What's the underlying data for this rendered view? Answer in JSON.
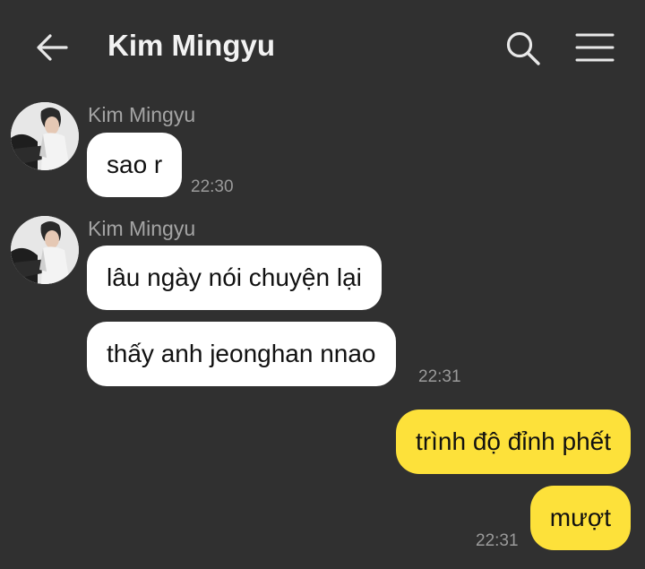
{
  "header": {
    "title": "Kim Mingyu",
    "icons": {
      "back": "arrow-left-icon",
      "search": "search-icon",
      "menu": "hamburger-menu-icon"
    }
  },
  "colors": {
    "background": "#303030",
    "incoming_bubble": "#ffffff",
    "outgoing_bubble": "#fde13a",
    "timestamp": "#9a9a9a"
  },
  "messages": [
    {
      "sender": "Kim Mingyu",
      "direction": "incoming",
      "bubbles": [
        "sao r"
      ],
      "time": "22:30"
    },
    {
      "sender": "Kim Mingyu",
      "direction": "incoming",
      "bubbles": [
        "lâu ngày nói chuyện lại",
        "thấy anh jeonghan nnao"
      ],
      "time": "22:31"
    },
    {
      "sender": "",
      "direction": "outgoing",
      "bubbles": [
        "trình độ đỉnh phết"
      ],
      "time": ""
    },
    {
      "sender": "",
      "direction": "outgoing",
      "bubbles": [
        "mượt"
      ],
      "time": "22:31"
    }
  ]
}
